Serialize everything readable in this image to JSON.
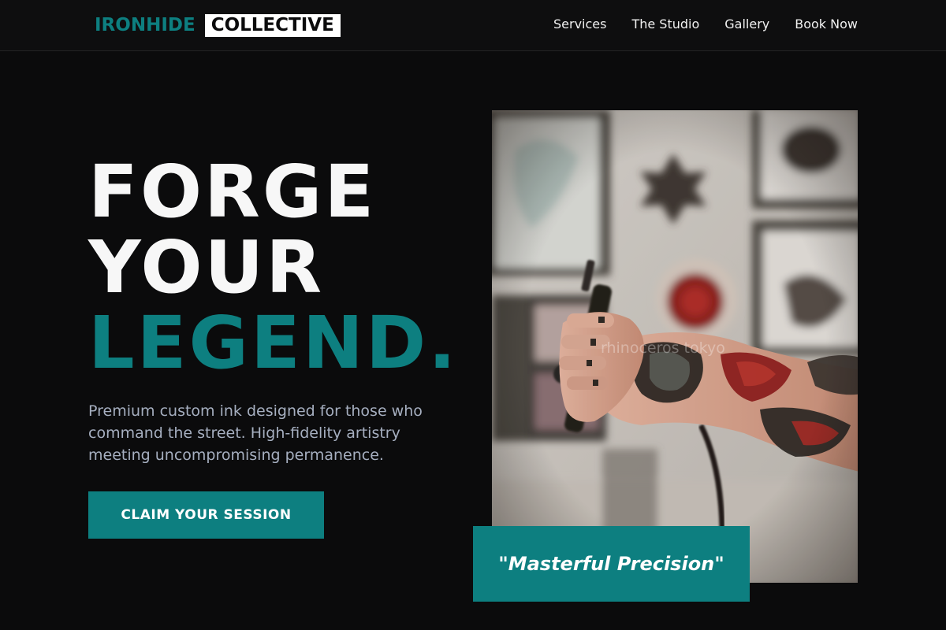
{
  "brand": {
    "part1": "IRONHIDE",
    "part2": "COLLECTIVE"
  },
  "nav": {
    "items": [
      "Services",
      "The Studio",
      "Gallery",
      "Book Now"
    ]
  },
  "hero": {
    "line1": "FORGE",
    "line2": "YOUR",
    "line3": "LEGEND.",
    "description": "Premium custom ink designed for those who command the street. High-fidelity artistry meeting uncompromising permanence.",
    "cta_label": "CLAIM YOUR SESSION"
  },
  "feature_image": {
    "watermark": "rhinoceros tokyo"
  },
  "quote": {
    "text": "\"Masterful Precision\""
  },
  "colors": {
    "accent": "#0d7f80",
    "background": "#0b0b0c",
    "description_text": "#a6afc0"
  }
}
